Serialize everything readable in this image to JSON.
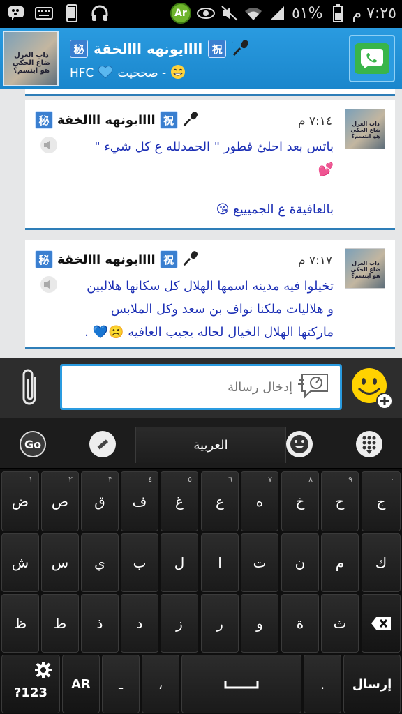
{
  "status_bar": {
    "time": "٧:٢٥ م",
    "battery_percent": "٥١%",
    "left_icons": [
      "bbm-icon",
      "keyboard-icon",
      "phone-icon",
      "headset-icon"
    ],
    "right_icons": [
      "ar-badge",
      "eye-icon",
      "mute-icon",
      "wifi-icon",
      "signal-icon",
      "battery-icon"
    ],
    "ar_badge": "Ar"
  },
  "header": {
    "contact_name": "اااايونهه ااالخقة",
    "contact_status_prefix": "HFC",
    "contact_status_suffix": "- صححيت",
    "avatar_text": "ذاب الغزل ضاع الحكي هو ابتسم؟",
    "secret_chip": "秘",
    "celebrate_chip": "祝"
  },
  "messages": [
    {
      "sender": "اااايونهه ااالخقة",
      "time": "٧:١٤ م",
      "lines": [
        "باتس بعد احلئ فطور \" الحمدلله ع كل شيء \"",
        "💕",
        "",
        "بالعافيةة ع الجميييع 😘"
      ]
    },
    {
      "sender": "اااايونهه ااالخقة",
      "time": "٧:١٧ م",
      "lines": [
        "تخيلوا فيه مدينه اسمها الهلال كل سكانها هلالبين",
        "و هلاليات ملكنا نواف بن سعد وكل الملابس",
        "ماركتها الهلال الخيال لحاله يجيب العافيه ☹️💙 ."
      ]
    }
  ],
  "input": {
    "placeholder": "إدخال رسالة"
  },
  "keyboard": {
    "language": "العربية",
    "row1": [
      {
        "char": "ض",
        "num": "١"
      },
      {
        "char": "ص",
        "num": "٢"
      },
      {
        "char": "ق",
        "num": "٣"
      },
      {
        "char": "ف",
        "num": "٤"
      },
      {
        "char": "غ",
        "num": "٥"
      },
      {
        "char": "ع",
        "num": "٦"
      },
      {
        "char": "ه",
        "num": "٧"
      },
      {
        "char": "خ",
        "num": "٨"
      },
      {
        "char": "ح",
        "num": "٩"
      },
      {
        "char": "ج",
        "num": "٠"
      }
    ],
    "row2": [
      "ش",
      "س",
      "ي",
      "ب",
      "ل",
      "ا",
      "ت",
      "ن",
      "م",
      "ك"
    ],
    "row3": [
      "ظ",
      "ط",
      "ذ",
      "د",
      "ز",
      "ر",
      "و",
      "ة",
      "ث"
    ],
    "symbols_key": "?123",
    "lang_key": "AR",
    "comma_key": "،",
    "dash_key": "ـ",
    "period_key": ".",
    "send_key": "إرسال"
  },
  "colors": {
    "header_blue": "#1a86cc",
    "message_text": "#1c2fb5",
    "card_border": "#2e7eb8",
    "call_green": "#39b54a"
  }
}
